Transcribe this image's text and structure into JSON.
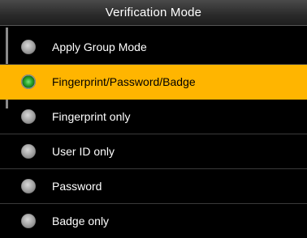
{
  "header": {
    "title": "Verification Mode"
  },
  "colors": {
    "background": "#000000",
    "selected_row": "#ffb500",
    "radio_selected": "#29a82a",
    "radio_unselected": "#a8a8a8"
  },
  "options": [
    {
      "label": "Apply Group Mode",
      "selected": false
    },
    {
      "label": "Fingerprint/Password/Badge",
      "selected": true
    },
    {
      "label": "Fingerprint only",
      "selected": false
    },
    {
      "label": "User ID only",
      "selected": false
    },
    {
      "label": "Password",
      "selected": false
    },
    {
      "label": "Badge only",
      "selected": false
    }
  ]
}
